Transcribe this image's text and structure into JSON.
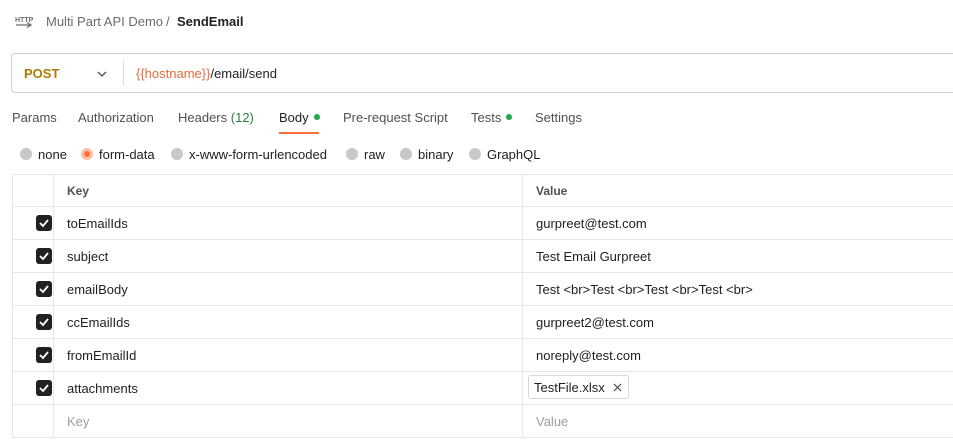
{
  "breadcrumb": {
    "collection": "Multi Part API Demo",
    "separator": "/",
    "request": "SendEmail"
  },
  "url_bar": {
    "method": "POST",
    "url_variable": "{{hostname}}",
    "url_path": "/email/send"
  },
  "tabs": [
    {
      "label": "Params"
    },
    {
      "label": "Authorization"
    },
    {
      "label": "Headers",
      "count": "(12)"
    },
    {
      "label": "Body",
      "active": true,
      "dot": true
    },
    {
      "label": "Pre-request Script"
    },
    {
      "label": "Tests",
      "dot": true
    },
    {
      "label": "Settings"
    }
  ],
  "body_modes": [
    {
      "label": "none"
    },
    {
      "label": "form-data",
      "selected": true
    },
    {
      "label": "x-www-form-urlencoded"
    },
    {
      "label": "raw"
    },
    {
      "label": "binary"
    },
    {
      "label": "GraphQL"
    }
  ],
  "table": {
    "headers": {
      "key": "Key",
      "value": "Value"
    },
    "rows": [
      {
        "key": "toEmailIds",
        "value": "gurpreet@test.com",
        "checked": true
      },
      {
        "key": "subject",
        "value": "Test Email Gurpreet",
        "checked": true
      },
      {
        "key": "emailBody",
        "value": "Test <br>Test <br>Test <br>Test <br>",
        "checked": true
      },
      {
        "key": "ccEmailIds",
        "value": "gurpreet2@test.com",
        "checked": true
      },
      {
        "key": "fromEmailId",
        "value": "noreply@test.com",
        "checked": true
      },
      {
        "key": "attachments",
        "file": "TestFile.xlsx",
        "checked": true
      }
    ],
    "empty_row": {
      "key_placeholder": "Key",
      "value_placeholder": "Value"
    }
  },
  "colors": {
    "accent": "#ff6c37",
    "method": "#ad7a03",
    "variable": "#e66b3c",
    "status_dot": "#1fa84f"
  },
  "icons": {
    "request": "http-icon",
    "method_dropdown": "chevron-down-icon",
    "checkbox": "check-icon",
    "remove_file": "close-icon"
  }
}
